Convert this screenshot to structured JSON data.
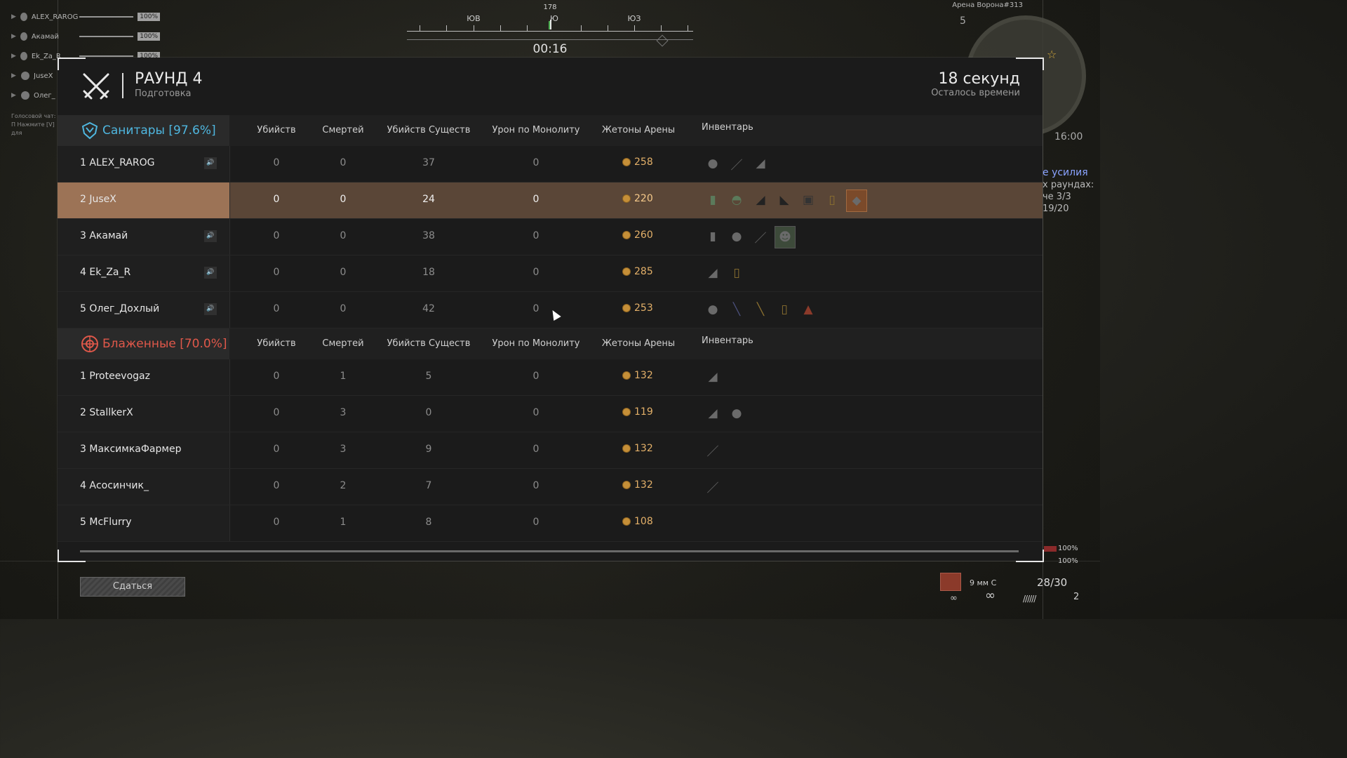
{
  "compass": {
    "degree": "178",
    "left_dir": "ЮВ",
    "center_dir": "Ю",
    "right_dir": "ЮЗ",
    "timer": "00:16"
  },
  "squad": [
    {
      "name": "ALEX_RAROG",
      "hp": "100%"
    },
    {
      "name": "Акамай",
      "hp": "100%"
    },
    {
      "name": "Ek_Za_R",
      "hp": "100%"
    },
    {
      "name": "JuseX",
      "hp": ""
    },
    {
      "name": "Олег_",
      "hp": ""
    }
  ],
  "voice_hint": "Голосовой чат: П Нажмите [V] для",
  "minimap": {
    "arena": "Арена Ворона#313",
    "number": "5",
    "clock": "16:00"
  },
  "quest": {
    "title": "е усилия",
    "line1": "х раундах:",
    "line2": "че 3/3",
    "line3": "19/20"
  },
  "header": {
    "round": "РАУНД 4",
    "phase": "Подготовка",
    "time_value": "18 секунд",
    "time_label": "Осталось времени"
  },
  "columns": [
    "Убийств",
    "Смертей",
    "Убийств Существ",
    "Урон по Монолиту",
    "Жетоны Арены",
    "Инвентарь"
  ],
  "teams": [
    {
      "name": "Санитары [97.6%]",
      "color": "#4fb7e0",
      "players": [
        {
          "rank": "1",
          "name": "ALEX_RAROG",
          "speaker": true,
          "kills": "0",
          "deaths": "0",
          "creatures": "37",
          "monolith": "0",
          "tokens": "258",
          "items": [
            "grenade-icon",
            "knife-icon",
            "pistol-icon"
          ]
        },
        {
          "rank": "2",
          "name": "JuseX",
          "speaker": false,
          "me": true,
          "kills": "0",
          "deaths": "0",
          "creatures": "24",
          "monolith": "0",
          "tokens": "220",
          "items": [
            "bottle-icon",
            "helmet-icon",
            "rifle-icon",
            "pistol-icon",
            "vest-icon",
            "canister-icon",
            "artifact-icon"
          ]
        },
        {
          "rank": "3",
          "name": "Акамай",
          "speaker": true,
          "kills": "0",
          "deaths": "0",
          "creatures": "38",
          "monolith": "0",
          "tokens": "260",
          "items": [
            "can-icon",
            "grenade-icon",
            "knife-icon",
            "mask-icon"
          ]
        },
        {
          "rank": "4",
          "name": "Ek_Za_R",
          "speaker": true,
          "kills": "0",
          "deaths": "0",
          "creatures": "18",
          "monolith": "0",
          "tokens": "285",
          "items": [
            "pistol-icon",
            "canister-icon"
          ]
        },
        {
          "rank": "5",
          "name": "Олег_Дохлый",
          "speaker": true,
          "kills": "0",
          "deaths": "0",
          "creatures": "42",
          "monolith": "0",
          "tokens": "253",
          "items": [
            "grenade-icon",
            "syringe-icon",
            "shotgun-icon",
            "canister-icon",
            "armor-icon"
          ]
        }
      ]
    },
    {
      "name": "Блаженные [70.0%]",
      "color": "#e0584a",
      "players": [
        {
          "rank": "1",
          "name": "Proteevogaz",
          "speaker": false,
          "kills": "0",
          "deaths": "1",
          "creatures": "5",
          "monolith": "0",
          "tokens": "132",
          "items": [
            "pistol-icon"
          ]
        },
        {
          "rank": "2",
          "name": "StallkerX",
          "speaker": false,
          "kills": "0",
          "deaths": "3",
          "creatures": "0",
          "monolith": "0",
          "tokens": "119",
          "items": [
            "pistol-icon",
            "grenade-icon"
          ]
        },
        {
          "rank": "3",
          "name": "МаксимкаФармер",
          "speaker": false,
          "kills": "0",
          "deaths": "3",
          "creatures": "9",
          "monolith": "0",
          "tokens": "132",
          "items": [
            "knife-icon"
          ]
        },
        {
          "rank": "4",
          "name": "Асосинчик_",
          "speaker": false,
          "kills": "0",
          "deaths": "2",
          "creatures": "7",
          "monolith": "0",
          "tokens": "132",
          "items": [
            "knife-icon"
          ]
        },
        {
          "rank": "5",
          "name": "McFlurry",
          "speaker": false,
          "kills": "0",
          "deaths": "1",
          "creatures": "8",
          "monolith": "0",
          "tokens": "108",
          "items": []
        }
      ]
    }
  ],
  "surrender_label": "Сдаться",
  "hud": {
    "armor_pct": "100%",
    "stamina_pct": "100%",
    "ammo_type": "9 мм С",
    "ammo_count": "28/30",
    "grenades": "2",
    "infinity": "∞"
  }
}
